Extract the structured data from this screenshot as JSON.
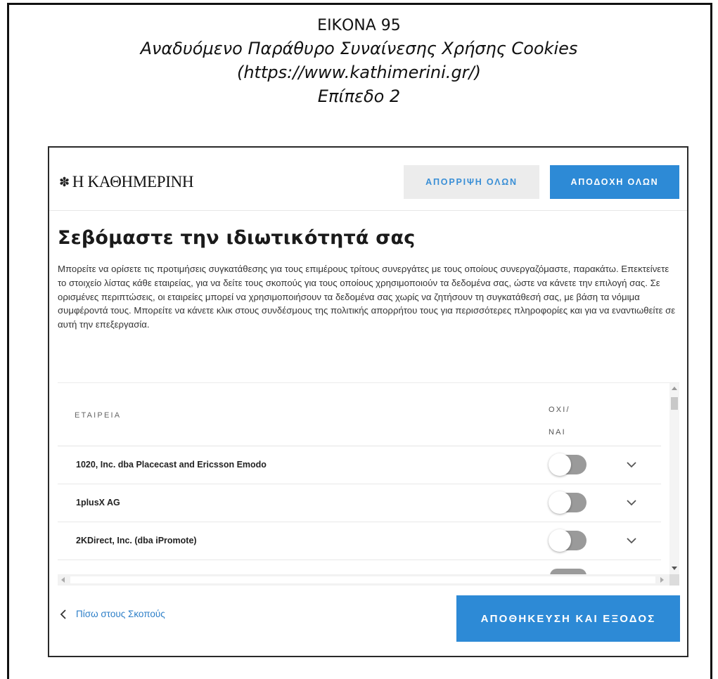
{
  "caption": {
    "figure": "ΕΙΚΟΝΑ 95",
    "title": "Αναδυόμενο Παράθυρο Συναίνεσης Χρήσης Cookies",
    "url": "(https://www.kathimerini.gr/)",
    "level": "Επίπεδο 2"
  },
  "dialog": {
    "logo_text": "Η ΚΑΘΗΜΕΡΙΝΗ",
    "reject_all_label": "ΑΠΟΡΡΙΨΗ ΟΛΩΝ",
    "accept_all_label": "ΑΠΟΔΟΧΗ ΟΛΩΝ",
    "title": "Σεβόμαστε την ιδιωτικότητά σας",
    "description": "Μπορείτε να ορίσετε τις προτιμήσεις συγκατάθεσης για τους επιμέρους τρίτους συνεργάτες με τους οποίους συνεργαζόμαστε, παρακάτω. Επεκτείνετε το στοιχείο λίστας κάθε εταιρείας, για να δείτε τους σκοπούς για τους οποίους χρησιμοποιούν τα δεδομένα σας, ώστε να κάνετε την επιλογή σας. Σε ορισμένες περιπτώσεις, οι εταιρείες μπορεί να χρησιμοποιήσουν τα δεδομένα σας χωρίς να ζητήσουν τη συγκατάθεσή σας, με βάση τα νόμιμα συμφέροντά τους. Μπορείτε να κάνετε κλικ στους συνδέσμους της πολιτικής απορρήτου τους για περισσότερες πληροφορίες και για να εναντιωθείτε σε αυτή την επεξεργασία.",
    "table": {
      "col_company": "ΕΤΑΙΡΕΙΑ",
      "col_toggle_line1": "ΟΧΙ/",
      "col_toggle_line2": "ΝΑΙ",
      "rows": [
        {
          "name": "1020, Inc. dba Placecast and Ericsson Emodo",
          "enabled": false
        },
        {
          "name": "1plusX AG",
          "enabled": false
        },
        {
          "name": "2KDirect, Inc. (dba iPromote)",
          "enabled": false
        }
      ]
    },
    "back_link_label": "Πίσω στους Σκοπούς",
    "save_exit_label": "ΑΠΟΘΗΚΕΥΣΗ ΚΑΙ ΕΞΟΔΟΣ"
  },
  "colors": {
    "accent_blue": "#2d8ad6",
    "toggle_off": "#9a9a9a",
    "reject_bg": "#ececec"
  }
}
